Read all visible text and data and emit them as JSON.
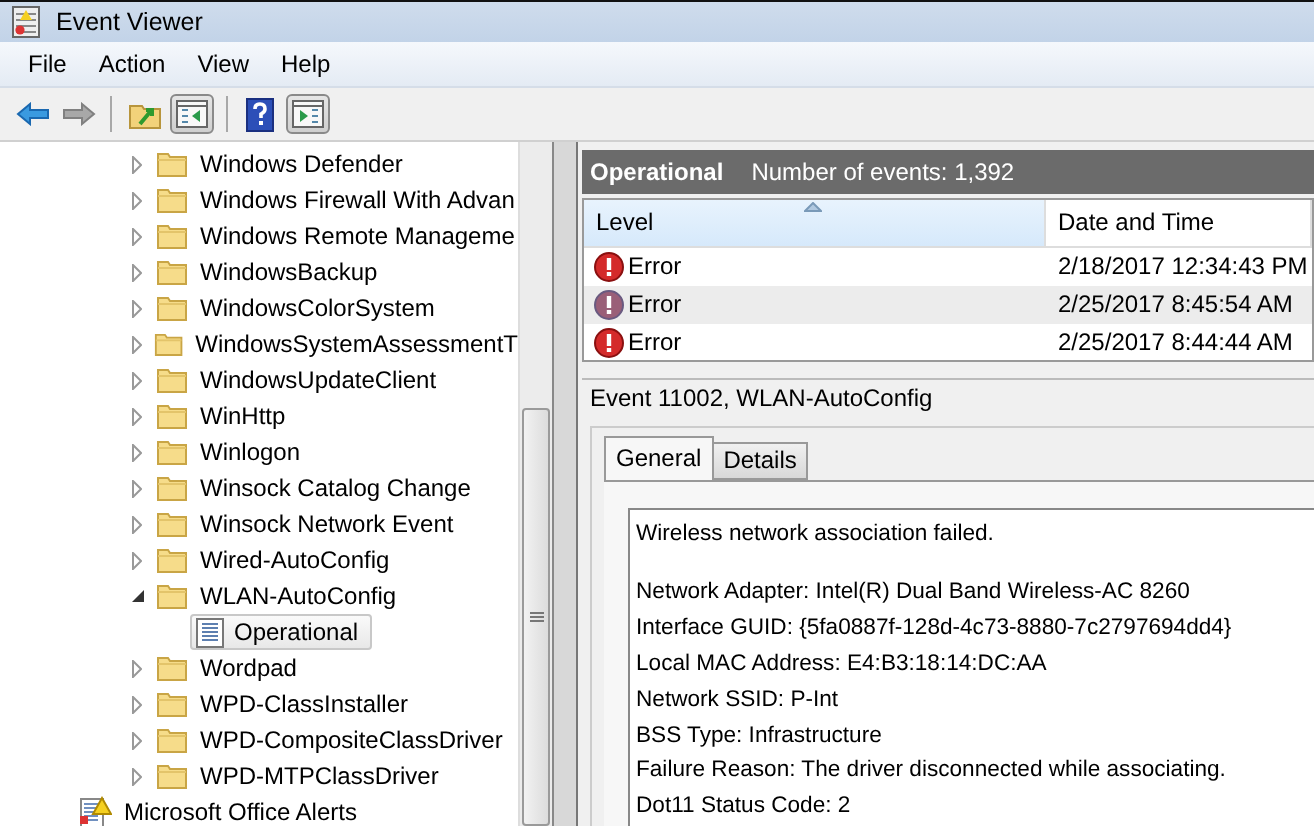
{
  "window": {
    "title": "Event Viewer"
  },
  "menu": [
    "File",
    "Action",
    "View",
    "Help"
  ],
  "toolbar": [
    {
      "kind": "back",
      "disabled": false,
      "pressed": false
    },
    {
      "kind": "forward",
      "disabled": true,
      "pressed": false
    },
    {
      "kind": "up",
      "disabled": false,
      "pressed": false
    },
    {
      "kind": "tree-pane",
      "disabled": false,
      "pressed": true
    },
    {
      "kind": "help",
      "disabled": false,
      "pressed": false
    },
    {
      "kind": "action-pane",
      "disabled": false,
      "pressed": true
    }
  ],
  "tree": {
    "folders": [
      {
        "label": "Windows Defender",
        "expanded": false
      },
      {
        "label": "Windows Firewall With Advan",
        "expanded": false
      },
      {
        "label": "Windows Remote Manageme",
        "expanded": false
      },
      {
        "label": "WindowsBackup",
        "expanded": false
      },
      {
        "label": "WindowsColorSystem",
        "expanded": false
      },
      {
        "label": "WindowsSystemAssessmentT",
        "expanded": false
      },
      {
        "label": "WindowsUpdateClient",
        "expanded": false
      },
      {
        "label": "WinHttp",
        "expanded": false
      },
      {
        "label": "Winlogon",
        "expanded": false
      },
      {
        "label": "Winsock Catalog Change",
        "expanded": false
      },
      {
        "label": "Winsock Network Event",
        "expanded": false
      },
      {
        "label": "Wired-AutoConfig",
        "expanded": false
      },
      {
        "label": "WLAN-AutoConfig",
        "expanded": true,
        "children": [
          {
            "label": "Operational",
            "selected": true
          }
        ]
      },
      {
        "label": "Wordpad",
        "expanded": false
      },
      {
        "label": "WPD-ClassInstaller",
        "expanded": false
      },
      {
        "label": "WPD-CompositeClassDriver",
        "expanded": false
      },
      {
        "label": "WPD-MTPClassDriver",
        "expanded": false
      }
    ],
    "following_items": [
      {
        "label": "Microsoft Office Alerts"
      }
    ]
  },
  "log_header": {
    "name": "Operational",
    "count": "Number of events: 1,392"
  },
  "table": {
    "columns": [
      {
        "label": "Level",
        "sorted": true
      },
      {
        "label": "Date and Time",
        "sorted": false
      }
    ],
    "rows": [
      {
        "level": "Error",
        "date": "2/18/2017 12:34:43 PM",
        "selected": false
      },
      {
        "level": "Error",
        "date": "2/25/2017 8:45:54 AM",
        "selected": true
      },
      {
        "level": "Error",
        "date": "2/25/2017 8:44:44 AM",
        "selected": false
      }
    ]
  },
  "event": {
    "title": "Event 11002, WLAN-AutoConfig",
    "tabs": [
      {
        "label": "General",
        "selected": true
      },
      {
        "label": "Details",
        "selected": false
      }
    ],
    "summary": "Wireless network association failed.",
    "details": [
      "Network Adapter: Intel(R) Dual Band Wireless-AC 8260",
      "Interface GUID: {5fa0887f-128d-4c73-8880-7c2797694dd4}",
      "Local MAC Address: E4:B3:18:14:DC:AA",
      "Network SSID: P-Int",
      "BSS Type: Infrastructure",
      "Failure Reason: The driver disconnected while associating.",
      "Dot11 Status Code: 2"
    ]
  }
}
